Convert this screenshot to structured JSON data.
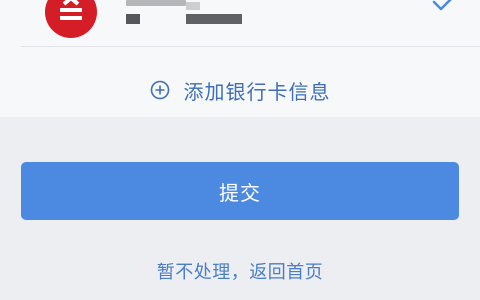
{
  "account": {
    "bank_logo_icon": "bank-logo",
    "selected_icon": "check-icon"
  },
  "add_card": {
    "label": "添加银行卡信息",
    "icon": "plus-circle-icon"
  },
  "submit": {
    "label": "提交"
  },
  "skip": {
    "label": "暂不处理，返回首页"
  },
  "colors": {
    "accent": "#4b8ae0",
    "link": "#4a7ec8",
    "bank_red": "#d51d27",
    "background": "#eceef2"
  }
}
